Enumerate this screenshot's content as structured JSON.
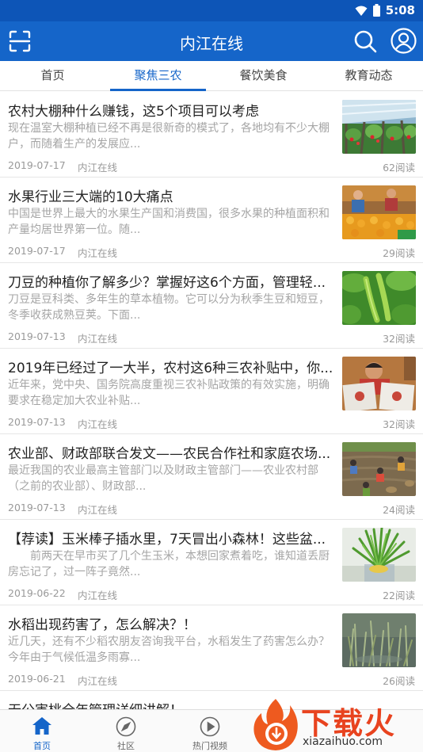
{
  "status_bar": {
    "time": "5:08",
    "wifi_icon": "wifi-icon",
    "battery_icon": "battery-icon"
  },
  "app_bar": {
    "title": "内江在线",
    "scan_icon": "scan-icon",
    "search_icon": "search-icon",
    "user_icon": "user-icon"
  },
  "tabs": [
    {
      "label": "首页",
      "active": false
    },
    {
      "label": "聚焦三农",
      "active": true
    },
    {
      "label": "餐饮美食",
      "active": false
    },
    {
      "label": "教育动态",
      "active": false
    }
  ],
  "articles": [
    {
      "title": "农村大棚种什么赚钱，这5个项目可以考虑",
      "summary": "现在温室大棚种植已经不再是很新奇的模式了，各地均有不少大棚户，而随着生产的发展应...",
      "date": "2019-07-17",
      "source": "内江在线",
      "reads": "62阅读",
      "thumb": "greenhouse-strawberry-image"
    },
    {
      "title": "水果行业三大端的10大痛点",
      "summary": "中国是世界上最大的水果生产国和消费国，很多水果的种植面积和产量均居世界第一位。随...",
      "date": "2019-07-17",
      "source": "内江在线",
      "reads": "29阅读",
      "thumb": "fruit-market-image"
    },
    {
      "title": "刀豆的种植你了解多少？掌握好这6个方面，管理轻...",
      "summary": "刀豆是豆科类、多年生的草本植物。它可以分为秋季生豆和短豆，冬季收获成熟豆荚。下面...",
      "date": "2019-07-13",
      "source": "内江在线",
      "reads": "32阅读",
      "thumb": "sword-bean-image"
    },
    {
      "title": "2019年已经过了一大半，农村这6种三农补贴中，你...",
      "summary": "近年来，党中央、国务院高度重视三农补贴政策的有效实施，明确要求在稳定加大农业补贴...",
      "date": "2019-07-13",
      "source": "内江在线",
      "reads": "32阅读",
      "thumb": "farmer-certificate-image"
    },
    {
      "title": "农业部、财政部联合发文——农民合作社和家庭农场...",
      "summary": "最近我国的农业最高主管部门以及财政主管部门——农业农村部（之前的农业部）、财政部...",
      "date": "2019-07-13",
      "source": "内江在线",
      "reads": "24阅读",
      "thumb": "field-harvest-image"
    },
    {
      "title": "【荐读】玉米棒子插水里，7天冒出小森林！这些盆...",
      "summary": "前两天在早市买了几个生玉米，本想回家煮着吃，谁知道丢厨房忘记了，过一阵子竟然...",
      "date": "2019-06-22",
      "source": "内江在线",
      "reads": "22阅读",
      "thumb": "corn-sprouts-image"
    },
    {
      "title": "水稻出现药害了，怎么解决？！",
      "summary": "近几天，还有不少稻农朋友咨询我平台，水稻发生了药害怎么办？今年由于气候低温多雨寡...",
      "date": "2019-06-21",
      "source": "内江在线",
      "reads": "26阅读",
      "thumb": "rice-paddy-image"
    },
    {
      "title": "无公害桃全年管理详细讲解！",
      "summary": "",
      "date": "",
      "source": "",
      "reads": "",
      "thumb": ""
    }
  ],
  "bottom_nav": [
    {
      "label": "首页",
      "icon": "home-icon",
      "active": true
    },
    {
      "label": "社区",
      "icon": "compass-icon",
      "active": false
    },
    {
      "label": "热门视频",
      "icon": "play-icon",
      "active": false
    },
    {
      "label": "",
      "icon": "",
      "active": false
    },
    {
      "label": "",
      "icon": "",
      "active": false
    }
  ],
  "watermark": {
    "title": "下载火",
    "url": "xiazaihuo.com"
  },
  "colors": {
    "primary": "#1565c9",
    "status": "#0d55b7",
    "text_gray": "#a5a5a5",
    "watermark": "#e8431f"
  }
}
